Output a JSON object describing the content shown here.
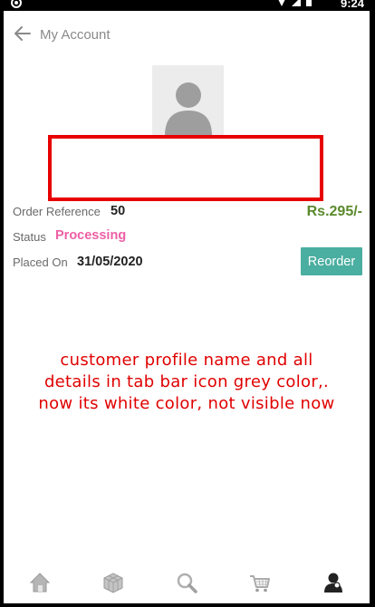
{
  "status_bar": {
    "time": "9:24",
    "icons": [
      "camera-icon",
      "wifi-icon",
      "signal-icon",
      "battery-icon"
    ]
  },
  "app_bar": {
    "title": "My Account",
    "back_icon": "arrow-left-icon"
  },
  "profile": {
    "avatar_icon": "person-silhouette-icon"
  },
  "order": {
    "reference_label": "Order Reference",
    "reference_value": "50",
    "price": "Rs.295/-",
    "status_label": "Status",
    "status_value": "Processing",
    "placed_label": "Placed On",
    "placed_value": "31/05/2020",
    "reorder_label": "Reorder"
  },
  "annotation": {
    "lines": [
      "customer profile name and all",
      "details in tab bar icon grey color,.",
      "now its white color, not visible now"
    ]
  },
  "tab_bar": {
    "tabs": [
      {
        "icon": "home-icon"
      },
      {
        "icon": "category-cube-icon"
      },
      {
        "icon": "search-icon"
      },
      {
        "icon": "cart-icon"
      },
      {
        "icon": "account-icon"
      }
    ]
  },
  "colors": {
    "accent_teal": "#4aaea0",
    "price_green": "#5a8a2c",
    "status_pink": "#ee5fa5",
    "annotation_red": "#e00000"
  }
}
